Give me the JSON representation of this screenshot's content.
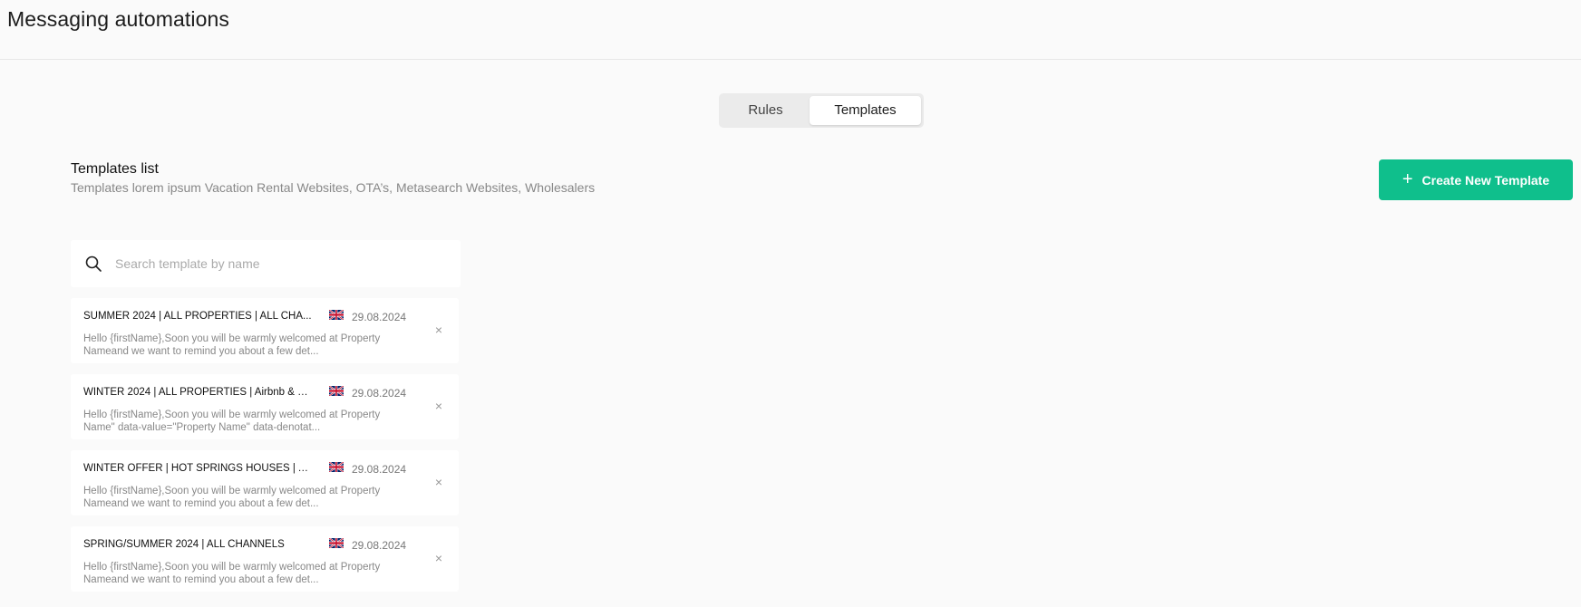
{
  "header": {
    "title": "Messaging automations"
  },
  "tabs": [
    {
      "label": "Rules",
      "active": false
    },
    {
      "label": "Templates",
      "active": true
    }
  ],
  "section": {
    "title": "Templates list",
    "subtitle": "Templates lorem ipsum Vacation Rental Websites, OTA’s, Metasearch Websites, Wholesalers",
    "create_label": "Create New Template"
  },
  "search": {
    "placeholder": "Search template by name",
    "value": ""
  },
  "templates": [
    {
      "title": "SUMMER 2024 | ALL PROPERTIES | ALL CHA...",
      "date": "29.08.2024",
      "preview_line1": "Hello {firstName},Soon you will be warmly welcomed at Property",
      "preview_line2": "Nameand we want to remind you about a few det..."
    },
    {
      "title": "WINTER 2024 | ALL PROPERTIES | Airbnb & B...",
      "date": "29.08.2024",
      "preview_line1": "Hello {firstName},Soon you will be warmly welcomed at Property",
      "preview_line2": "Name\" data-value=\"Property Name\" data-denotat..."
    },
    {
      "title": "WINTER OFFER | HOT SPRINGS HOUSES | ALL...",
      "date": "29.08.2024",
      "preview_line1": "Hello {firstName},Soon you will be warmly welcomed at Property",
      "preview_line2": "Nameand we want to remind you about a few det..."
    },
    {
      "title": "SPRING/SUMMER 2024 | ALL CHANNELS",
      "date": "29.08.2024",
      "preview_line1": "Hello {firstName},Soon you will be warmly welcomed at Property",
      "preview_line2": "Nameand we want to remind you about a few det..."
    }
  ],
  "icons": {
    "close": "×",
    "plus": "+"
  },
  "colors": {
    "accent": "#0fbf8c",
    "background": "#fafafa"
  }
}
